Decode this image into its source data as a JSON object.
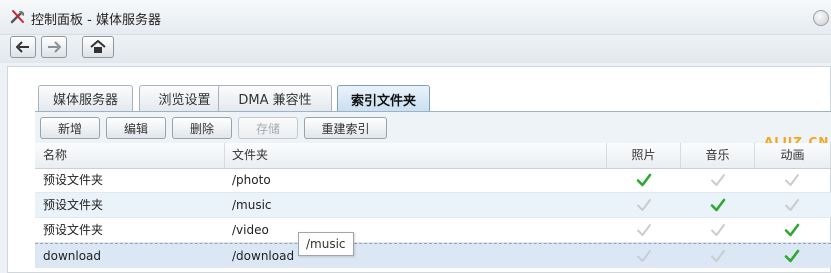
{
  "window": {
    "title": "控制面板 - 媒体服务器"
  },
  "tabs": [
    {
      "label": "媒体服务器",
      "active": false
    },
    {
      "label": "浏览设置",
      "active": false
    },
    {
      "label": "DMA 兼容性",
      "active": false
    },
    {
      "label": "索引文件夹",
      "active": true
    }
  ],
  "actions": [
    {
      "label": "新增",
      "enabled": true
    },
    {
      "label": "编辑",
      "enabled": true
    },
    {
      "label": "删除",
      "enabled": true
    },
    {
      "label": "存储",
      "enabled": false
    },
    {
      "label": "重建索引",
      "enabled": true
    }
  ],
  "watermark": "ALUZ.CN",
  "table": {
    "columns": [
      "名称",
      "文件夹",
      "照片",
      "音乐",
      "动画"
    ],
    "rows": [
      {
        "name": "预设文件夹",
        "folder": "/photo",
        "photo": true,
        "music": false,
        "video": false
      },
      {
        "name": "预设文件夹",
        "folder": "/music",
        "photo": false,
        "music": true,
        "video": false
      },
      {
        "name": "预设文件夹",
        "folder": "/video",
        "photo": false,
        "music": false,
        "video": true
      },
      {
        "name": "download",
        "folder": "/download",
        "photo": false,
        "music": false,
        "video": true
      }
    ]
  },
  "tooltip": "/music",
  "colors": {
    "check_on": "#2fa82f",
    "check_off": "#c9cdd1",
    "accent": "#f3a61e"
  },
  "icons": {
    "back": "arrow-left-icon",
    "forward": "arrow-right-icon",
    "home": "home-icon",
    "app": "control-panel-icon"
  }
}
